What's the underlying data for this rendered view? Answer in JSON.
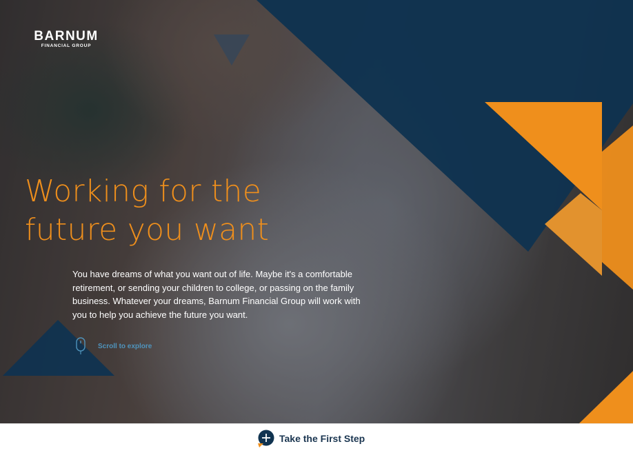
{
  "brand": {
    "name": "BARNUM",
    "subtitle": "FINANCIAL GROUP"
  },
  "hero": {
    "headline_line1": "Working for the",
    "headline_line2": "future you want",
    "body": "You have dreams of what you want out of life. Maybe it's a comfortable retirement, or sending your children to college, or passing on the family business. Whatever your dreams, Barnum Financial Group will work with you to help you achieve the future you want.",
    "scroll_label": "Scroll to explore"
  },
  "footer": {
    "cta_label": "Take the First Step"
  },
  "colors": {
    "navy": "#103350",
    "orange": "#ef8f1c",
    "link_blue": "#4f94bd"
  },
  "icons": {
    "scroll": "mouse-icon",
    "cta": "plus-circle-icon"
  }
}
